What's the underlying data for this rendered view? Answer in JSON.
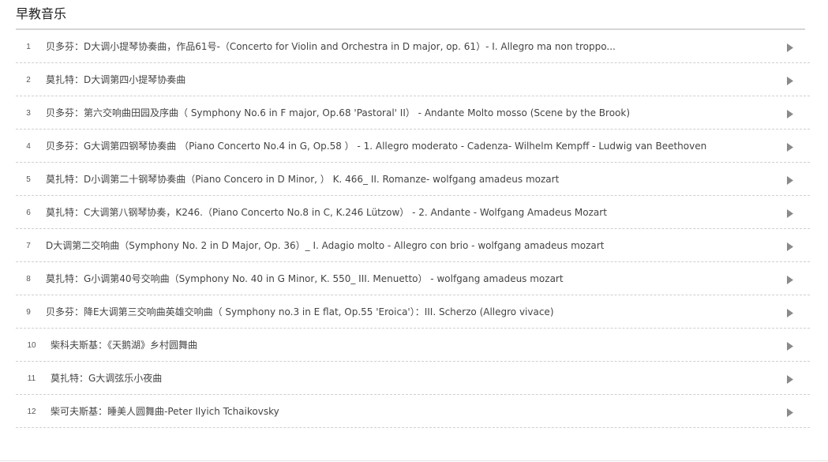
{
  "section": {
    "title": "早教音乐"
  },
  "colors": {
    "divider": "#d6d6d6",
    "row_border": "#cfcfcf",
    "text": "#444444",
    "play_icon": "#8a8a8a"
  },
  "tracks": [
    {
      "num": "1",
      "title": "贝多芬：D大调小提琴协奏曲，作品61号-（Concerto for Violin and Orchestra in D major, op. 61）- I. Allegro ma non troppo..."
    },
    {
      "num": "2",
      "title": "莫扎特：D大调第四小提琴协奏曲"
    },
    {
      "num": "3",
      "title": "贝多芬：第六交响曲田园及序曲（ Symphony No.6 in F major, Op.68 'Pastoral' II） - Andante Molto mosso (Scene by the Brook)"
    },
    {
      "num": "4",
      "title": "贝多芬：G大调第四钢琴协奏曲 （Piano Concerto No.4 in G, Op.58 ） - 1. Allegro moderato - Cadenza- Wilhelm Kempff - Ludwig van Beethoven"
    },
    {
      "num": "5",
      "title": "莫扎特：D小调第二十钢琴协奏曲（Piano Concero in D Minor, ） K. 466_ II. Romanze- wolfgang amadeus mozart"
    },
    {
      "num": "6",
      "title": "莫扎特：C大调第八钢琴协奏，K246.（Piano Concerto No.8 in C, K.246 Lützow） - 2. Andante - Wolfgang Amadeus Mozart"
    },
    {
      "num": "7",
      "title": "D大调第二交响曲（Symphony No. 2 in D Major, Op. 36）_ I. Adagio molto - Allegro con brio - wolfgang amadeus mozart"
    },
    {
      "num": "8",
      "title": "莫扎特：G小调第40号交响曲（Symphony No. 40 in G Minor, K. 550_ III. Menuetto） - wolfgang amadeus mozart"
    },
    {
      "num": "9",
      "title": "贝多芬：降E大调第三交响曲英雄交响曲（ Symphony no.3 in E flat, Op.55 'Eroica'）：III. Scherzo (Allegro vivace)"
    },
    {
      "num": "10",
      "title": "柴科夫斯基：《天鹅湖》乡村圆舞曲"
    },
    {
      "num": "11",
      "title": "莫扎特：G大调弦乐小夜曲"
    },
    {
      "num": "12",
      "title": "柴可夫斯基：睡美人圆舞曲-Peter Ilyich Tchaikovsky"
    }
  ]
}
